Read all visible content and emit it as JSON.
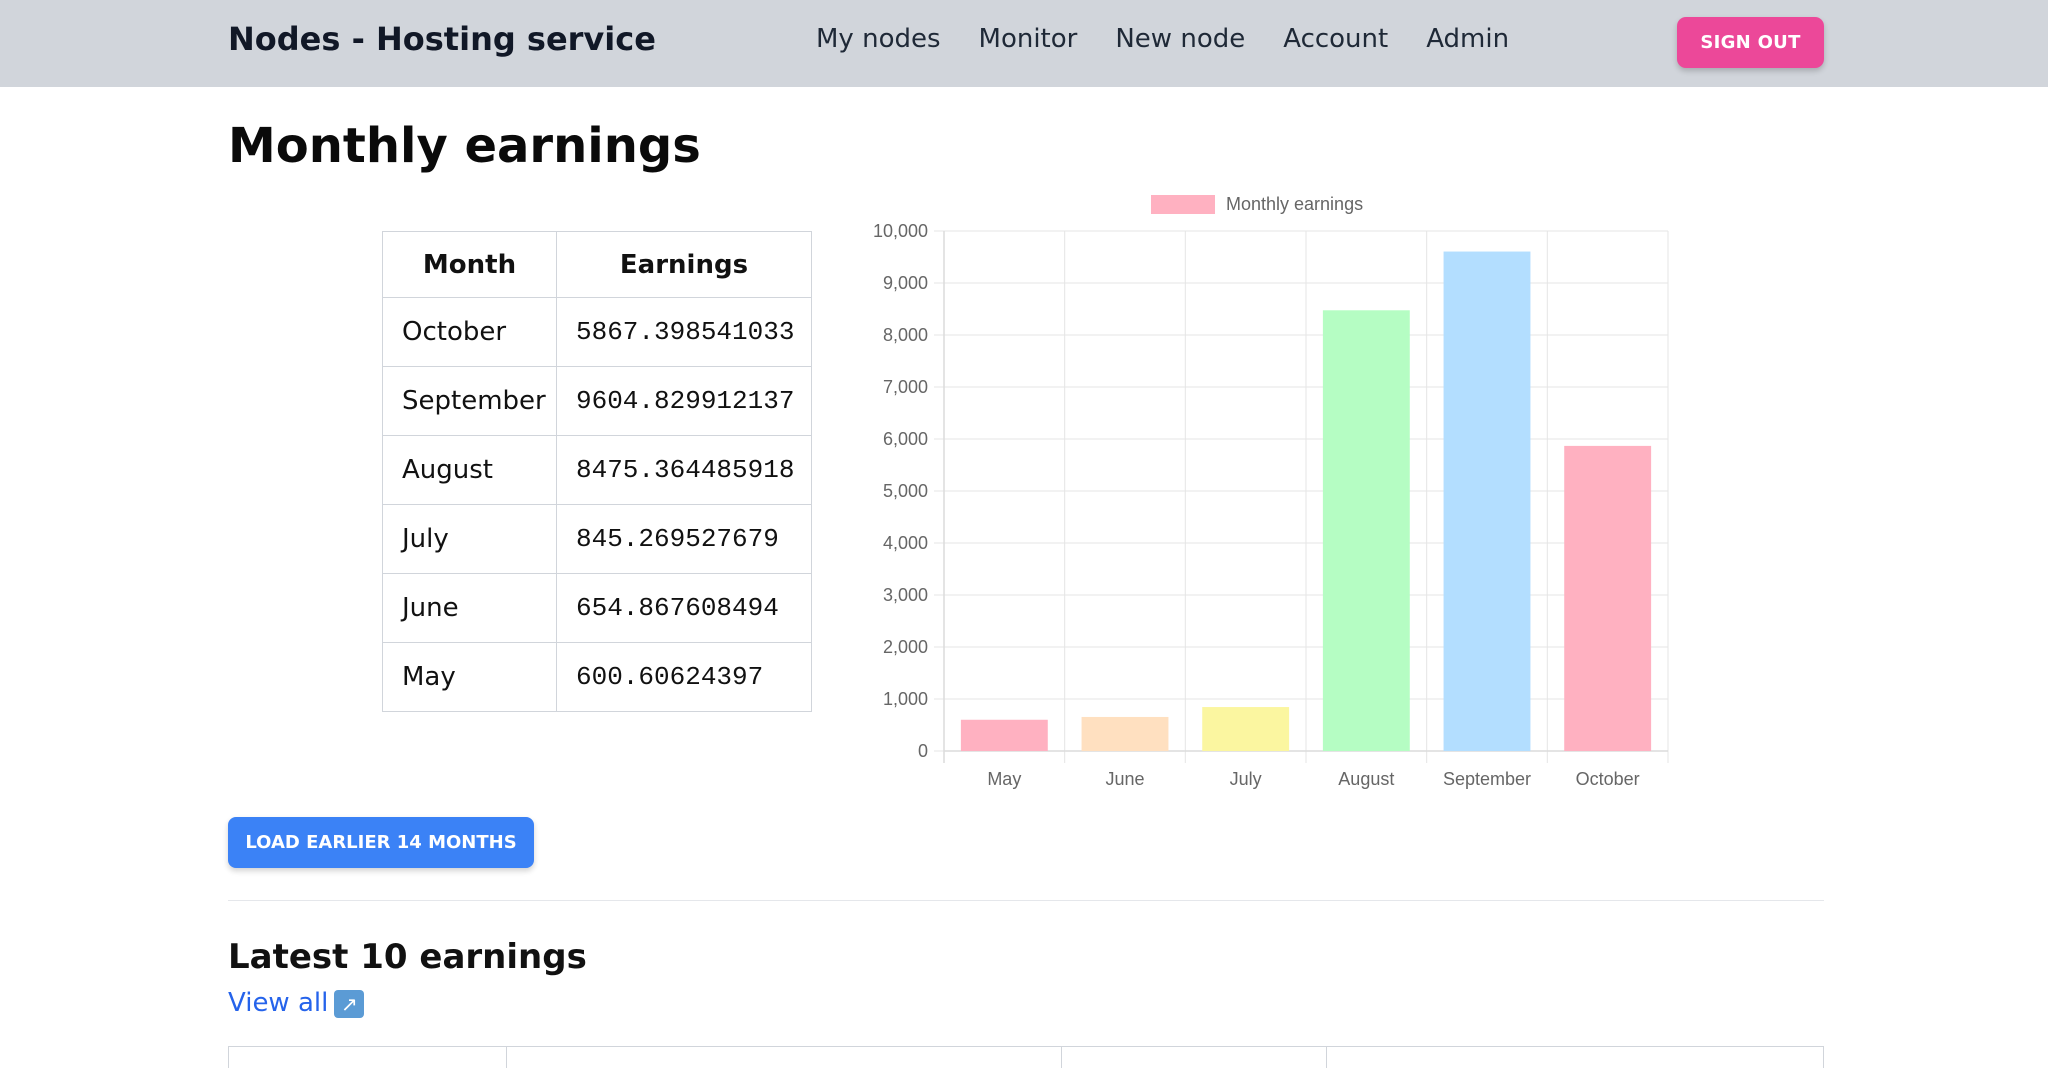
{
  "navbar": {
    "brand": "Nodes - Hosting service",
    "links": [
      "My nodes",
      "Monitor",
      "New node",
      "Account",
      "Admin"
    ],
    "signout_label": "SIGN OUT"
  },
  "page": {
    "title": "Monthly earnings",
    "load_earlier_label": "LOAD EARLIER 14 MONTHS",
    "latest_title": "Latest 10 earnings",
    "view_all_label": "View all",
    "view_all_icon": "external-link-arrow-icon"
  },
  "table": {
    "headers": [
      "Month",
      "Earnings"
    ],
    "rows": [
      [
        "October",
        "5867.398541033"
      ],
      [
        "September",
        "9604.829912137"
      ],
      [
        "August",
        "8475.364485918"
      ],
      [
        "July",
        "845.269527679"
      ],
      [
        "June",
        "654.867608494"
      ],
      [
        "May",
        "600.60624397"
      ]
    ]
  },
  "chart_data": {
    "type": "bar",
    "categories": [
      "May",
      "June",
      "July",
      "August",
      "September",
      "October"
    ],
    "series": [
      {
        "name": "Monthly earnings",
        "values": [
          600.60624397,
          654.867608494,
          845.269527679,
          8475.364485918,
          9604.829912137,
          5867.398541033
        ]
      }
    ],
    "colors": [
      "#ffb1c1",
      "#ffe0c0",
      "#fbf6a0",
      "#b5fdc3",
      "#b3deff",
      "#ffb1c1"
    ],
    "ylim": [
      0,
      10000
    ],
    "yticks": [
      "0",
      "1,000",
      "2,000",
      "3,000",
      "4,000",
      "5,000",
      "6,000",
      "7,000",
      "8,000",
      "9,000",
      "10,000"
    ],
    "grid": true,
    "legend": "top"
  }
}
